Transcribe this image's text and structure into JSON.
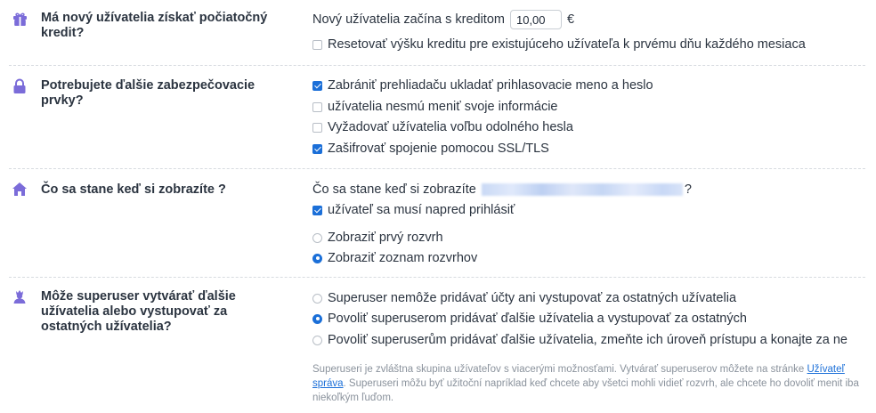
{
  "colors": {
    "accent": "#1b6fd8",
    "icon": "#7b6cd9",
    "text": "#2b3440",
    "muted": "#8a929c"
  },
  "sections": [
    {
      "icon": "gift-icon",
      "question": "Má nový užívatelia získať počiatočný kredit?",
      "credit_prefix": "Nový užívatelia začína s kreditom",
      "credit_value": "10,00",
      "credit_currency": "€",
      "options": [
        {
          "label": "Resetovať výšku kreditu pre existujúceho užívateľa k prvému dňu každého mesiaca",
          "checked": false
        }
      ]
    },
    {
      "icon": "lock-icon",
      "question": "Potrebujete ďalšie zabezpečovacie prvky?",
      "options": [
        {
          "label": "Zabrániť prehliadaču ukladať prihlasovacie meno a heslo",
          "checked": true
        },
        {
          "label": "užívatelia nesmú meniť svoje informácie",
          "checked": false
        },
        {
          "label": "Vyžadovať užívatelia voľbu odolného hesla",
          "checked": false
        },
        {
          "label": "Zašifrovať spojenie pomocou SSL/TLS",
          "checked": true
        }
      ]
    },
    {
      "icon": "home-icon",
      "question": "Čo sa stane keď si zobrazíte ?",
      "prompt_prefix": "Čo sa stane keď si zobrazíte",
      "prompt_suffix": "?",
      "login_label": "užívateľ sa musí napred prihlásiť",
      "login_checked": true,
      "radios": [
        {
          "label": "Zobraziť prvý rozvrh",
          "checked": false
        },
        {
          "label": "Zobraziť zoznam rozvrhov",
          "checked": true
        }
      ]
    },
    {
      "icon": "superuser-icon",
      "question": "Môže superuser vytvárať ďalšie užívatelia alebo vystupovať za ostatných užívatelia?",
      "radios": [
        {
          "label": "Superuser nemôže pridávať účty ani vystupovať za ostatných užívatelia",
          "checked": false
        },
        {
          "label": "Povoliť superuserom pridávať ďalšie užívatelia a vystupovať za ostatných",
          "checked": true
        },
        {
          "label": "Povoliť superuserům pridávať ďalšie užívatelia, zmeňte ich úroveň prístupu a konajte za ne",
          "checked": false
        }
      ],
      "note_before": "Superuseri je zvláštna skupina užívateľov s viacerými možnosťami. Vytvárať superuserov môžete na stránke ",
      "note_link": "Užívateľ správa",
      "note_after": ". Superuseri môžu byť užitoční napríklad keď chcete aby všetci mohli vidieť rozvrh, ale chcete ho dovoliť menit iba niekoľkým ľuďom."
    }
  ]
}
